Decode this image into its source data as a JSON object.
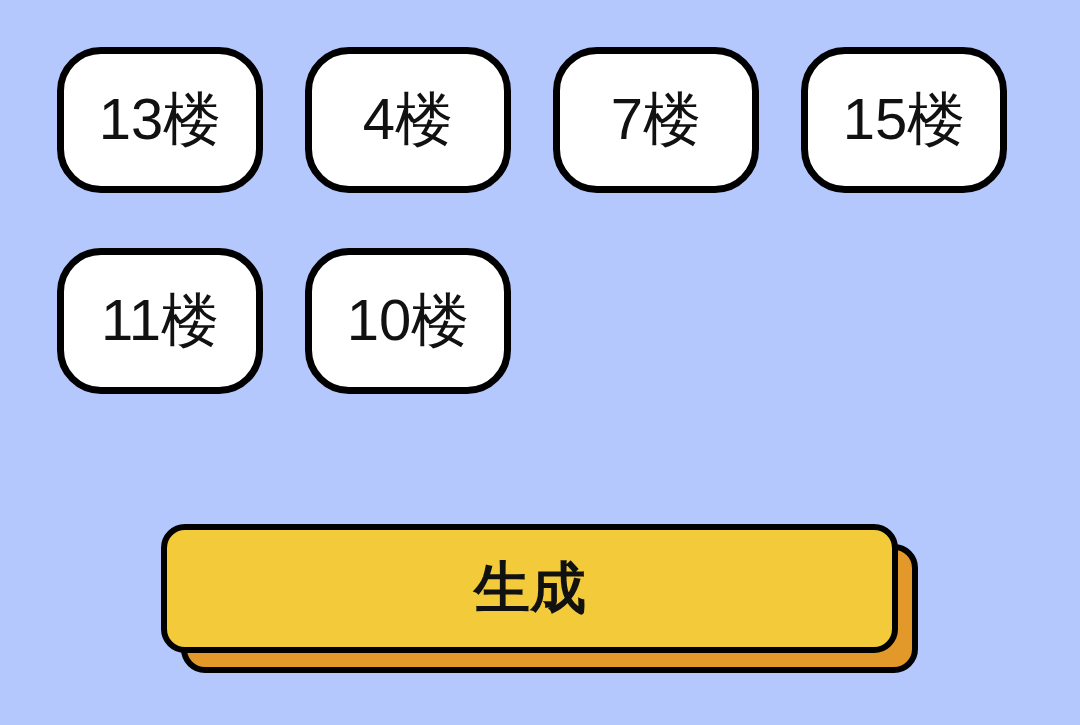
{
  "floor_chips": [
    {
      "label": "13楼"
    },
    {
      "label": "4楼"
    },
    {
      "label": "7楼"
    },
    {
      "label": "15楼"
    },
    {
      "label": "11楼"
    },
    {
      "label": "10楼"
    }
  ],
  "generate_button": {
    "label": "生成"
  }
}
